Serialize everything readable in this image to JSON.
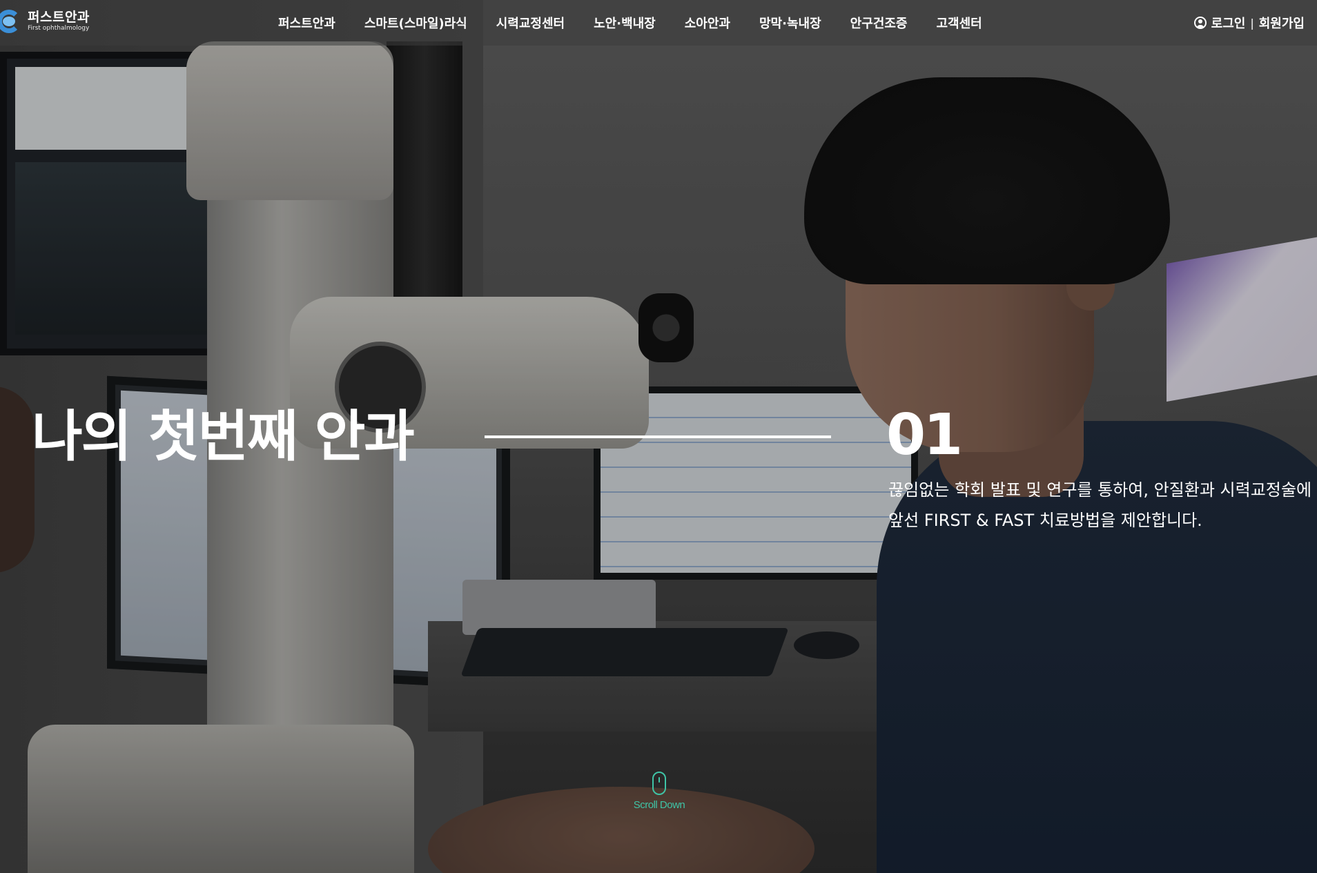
{
  "brand": {
    "name_ko": "퍼스트안과",
    "name_en": "First ophthalmology",
    "logo_colors": [
      "#3b8fd8",
      "#7cc0f2"
    ]
  },
  "nav": {
    "items": [
      "퍼스트안과",
      "스마트(스마일)라식",
      "시력교정센터",
      "노안·백내장",
      "소아안과",
      "망막·녹내장",
      "안구건조증",
      "고객센터"
    ]
  },
  "auth": {
    "login": "로그인",
    "separator": "|",
    "signup": "회원가입"
  },
  "hero": {
    "title": "나의 첫번째 안과",
    "number": "01",
    "desc_line1": "끊임없는 학회 발표 및 연구를 통하여, 안질환과 시력교정술에",
    "desc_line2": "앞선 FIRST & FAST 치료방법을 제안합니다."
  },
  "scroll": {
    "label": "Scroll Down",
    "color": "#3fc4a6"
  }
}
